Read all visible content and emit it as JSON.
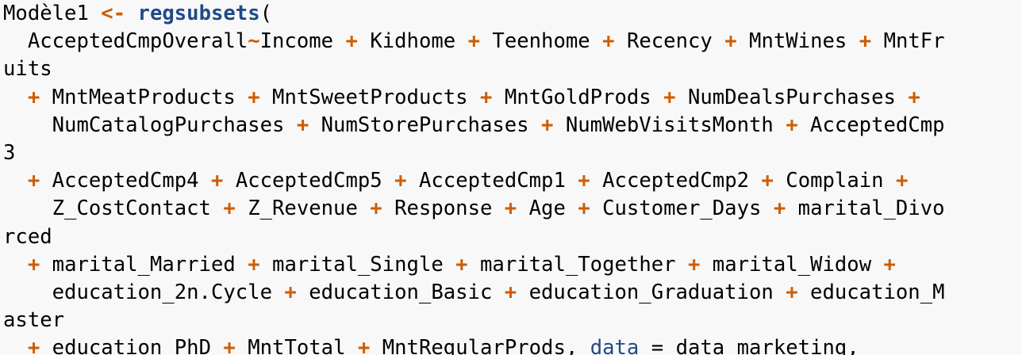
{
  "colors": {
    "background": "#f8f8f8",
    "text": "#000000",
    "operator": "#ce5c00",
    "function": "#204a87",
    "argument": "#204a87"
  },
  "code": {
    "language": "r",
    "lines": [
      [
        {
          "t": "Modèle1 ",
          "c": "plain"
        },
        {
          "t": "<-",
          "c": "op"
        },
        {
          "t": " ",
          "c": "plain"
        },
        {
          "t": "regsubsets",
          "c": "fn"
        },
        {
          "t": "(",
          "c": "plain"
        }
      ],
      [
        {
          "t": "  AcceptedCmpOverall",
          "c": "plain"
        },
        {
          "t": "~",
          "c": "op"
        },
        {
          "t": "Income ",
          "c": "plain"
        },
        {
          "t": "+",
          "c": "op"
        },
        {
          "t": " Kidhome ",
          "c": "plain"
        },
        {
          "t": "+",
          "c": "op"
        },
        {
          "t": " Teenhome ",
          "c": "plain"
        },
        {
          "t": "+",
          "c": "op"
        },
        {
          "t": " Recency ",
          "c": "plain"
        },
        {
          "t": "+",
          "c": "op"
        },
        {
          "t": " MntWines ",
          "c": "plain"
        },
        {
          "t": "+",
          "c": "op"
        },
        {
          "t": " MntFr",
          "c": "plain"
        }
      ],
      [
        {
          "t": "uits",
          "c": "plain"
        }
      ],
      [
        {
          "t": "  ",
          "c": "plain"
        },
        {
          "t": "+",
          "c": "op"
        },
        {
          "t": " MntMeatProducts ",
          "c": "plain"
        },
        {
          "t": "+",
          "c": "op"
        },
        {
          "t": " MntSweetProducts ",
          "c": "plain"
        },
        {
          "t": "+",
          "c": "op"
        },
        {
          "t": " MntGoldProds ",
          "c": "plain"
        },
        {
          "t": "+",
          "c": "op"
        },
        {
          "t": " NumDealsPurchases ",
          "c": "plain"
        },
        {
          "t": "+",
          "c": "op"
        }
      ],
      [
        {
          "t": "    NumCatalogPurchases ",
          "c": "plain"
        },
        {
          "t": "+",
          "c": "op"
        },
        {
          "t": " NumStorePurchases ",
          "c": "plain"
        },
        {
          "t": "+",
          "c": "op"
        },
        {
          "t": " NumWebVisitsMonth ",
          "c": "plain"
        },
        {
          "t": "+",
          "c": "op"
        },
        {
          "t": " AcceptedCmp",
          "c": "plain"
        }
      ],
      [
        {
          "t": "3",
          "c": "plain"
        }
      ],
      [
        {
          "t": "  ",
          "c": "plain"
        },
        {
          "t": "+",
          "c": "op"
        },
        {
          "t": " AcceptedCmp4 ",
          "c": "plain"
        },
        {
          "t": "+",
          "c": "op"
        },
        {
          "t": " AcceptedCmp5 ",
          "c": "plain"
        },
        {
          "t": "+",
          "c": "op"
        },
        {
          "t": " AcceptedCmp1 ",
          "c": "plain"
        },
        {
          "t": "+",
          "c": "op"
        },
        {
          "t": " AcceptedCmp2 ",
          "c": "plain"
        },
        {
          "t": "+",
          "c": "op"
        },
        {
          "t": " Complain ",
          "c": "plain"
        },
        {
          "t": "+",
          "c": "op"
        }
      ],
      [
        {
          "t": "    Z_CostContact ",
          "c": "plain"
        },
        {
          "t": "+",
          "c": "op"
        },
        {
          "t": " Z_Revenue ",
          "c": "plain"
        },
        {
          "t": "+",
          "c": "op"
        },
        {
          "t": " Response ",
          "c": "plain"
        },
        {
          "t": "+",
          "c": "op"
        },
        {
          "t": " Age ",
          "c": "plain"
        },
        {
          "t": "+",
          "c": "op"
        },
        {
          "t": " Customer_Days ",
          "c": "plain"
        },
        {
          "t": "+",
          "c": "op"
        },
        {
          "t": " marital_Divo",
          "c": "plain"
        }
      ],
      [
        {
          "t": "rced",
          "c": "plain"
        }
      ],
      [
        {
          "t": "  ",
          "c": "plain"
        },
        {
          "t": "+",
          "c": "op"
        },
        {
          "t": " marital_Married ",
          "c": "plain"
        },
        {
          "t": "+",
          "c": "op"
        },
        {
          "t": " marital_Single ",
          "c": "plain"
        },
        {
          "t": "+",
          "c": "op"
        },
        {
          "t": " marital_Together ",
          "c": "plain"
        },
        {
          "t": "+",
          "c": "op"
        },
        {
          "t": " marital_Widow ",
          "c": "plain"
        },
        {
          "t": "+",
          "c": "op"
        }
      ],
      [
        {
          "t": "    education_2n.Cycle ",
          "c": "plain"
        },
        {
          "t": "+",
          "c": "op"
        },
        {
          "t": " education_Basic ",
          "c": "plain"
        },
        {
          "t": "+",
          "c": "op"
        },
        {
          "t": " education_Graduation ",
          "c": "plain"
        },
        {
          "t": "+",
          "c": "op"
        },
        {
          "t": " education_M",
          "c": "plain"
        }
      ],
      [
        {
          "t": "aster",
          "c": "plain"
        }
      ],
      [
        {
          "t": "  ",
          "c": "plain"
        },
        {
          "t": "+",
          "c": "op"
        },
        {
          "t": " education_PhD ",
          "c": "plain"
        },
        {
          "t": "+",
          "c": "op"
        },
        {
          "t": " MntTotal ",
          "c": "plain"
        },
        {
          "t": "+",
          "c": "op"
        },
        {
          "t": " MntRegularProds, ",
          "c": "plain"
        },
        {
          "t": "data",
          "c": "arg"
        },
        {
          "t": " ",
          "c": "plain"
        },
        {
          "t": "=",
          "c": "plain"
        },
        {
          "t": " data_marketing,",
          "c": "plain"
        }
      ]
    ]
  }
}
